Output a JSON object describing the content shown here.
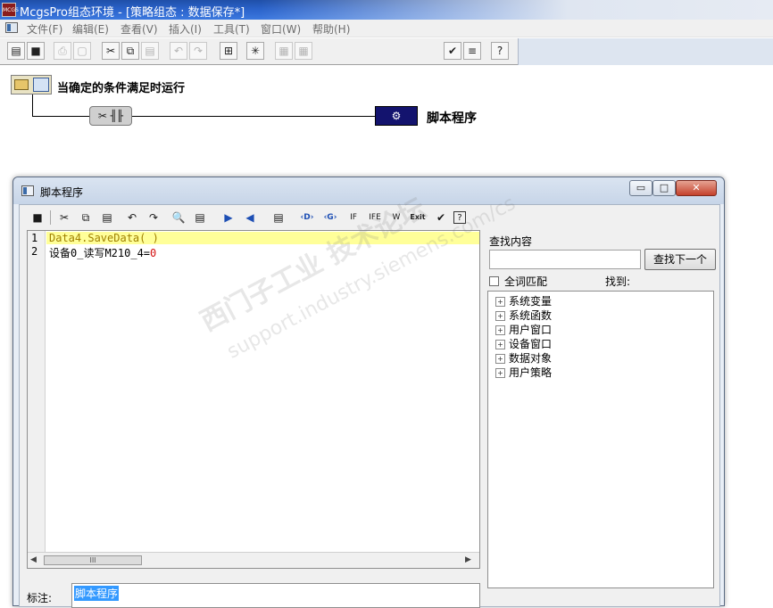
{
  "window": {
    "title": "McgsPro组态环境 - [策略组态 : 数据保存*]",
    "app_icon": "MCGS"
  },
  "menu": [
    "文件(F)",
    "编辑(E)",
    "查看(V)",
    "插入(I)",
    "工具(T)",
    "窗口(W)",
    "帮助(H)"
  ],
  "toolbar": {
    "icons": [
      "new-window-icon",
      "save-icon",
      "print-icon",
      "print-preview-icon",
      "cut-icon",
      "copy-icon",
      "paste-icon",
      "undo-icon",
      "redo-icon",
      "condition-icon",
      "strategy-row-icon",
      "block-icon",
      "block2-icon",
      "check-icon",
      "compile-icon",
      "help-icon"
    ]
  },
  "strategy": {
    "condition_label": "当确定的条件满足时运行",
    "script_node_label": "脚本程序"
  },
  "dialog": {
    "title": "脚本程序",
    "buttons": {
      "minimize": "▭",
      "maximize": "□",
      "close": "✕"
    },
    "toolbar": {
      "cut": "✂",
      "copy": "⧉",
      "paste": "▤",
      "undo": "↶",
      "redo": "↷",
      "find": "🔍",
      "replace": "▤",
      "import": "▶",
      "export": "◀",
      "comment": "▤",
      "tag_d": "‹D›",
      "tag_g": "‹G›",
      "if": "IF",
      "ife": "IFE",
      "while": "W",
      "exit": "Exit",
      "check": "✔",
      "help": "?"
    },
    "editor": {
      "lines": [
        {
          "num": "1",
          "text": "Data4.SaveData( )"
        },
        {
          "num": "2",
          "text": "设备0_读写M210_4=",
          "value": "0"
        }
      ],
      "scroll_thumb": "III"
    },
    "note": {
      "label": "标注:",
      "value": "脚本程序"
    },
    "search": {
      "title": "查找内容",
      "value": "",
      "find_next": "查找下一个",
      "match_all": "全词匹配",
      "found": "找到:",
      "tree": [
        "系统变量",
        "系统函数",
        "用户窗口",
        "设备窗口",
        "数据对象",
        "用户策略"
      ]
    }
  },
  "watermark": {
    "line1": "西门子工业  技术论坛",
    "line2": "support.industry.siemens.com/cs"
  }
}
